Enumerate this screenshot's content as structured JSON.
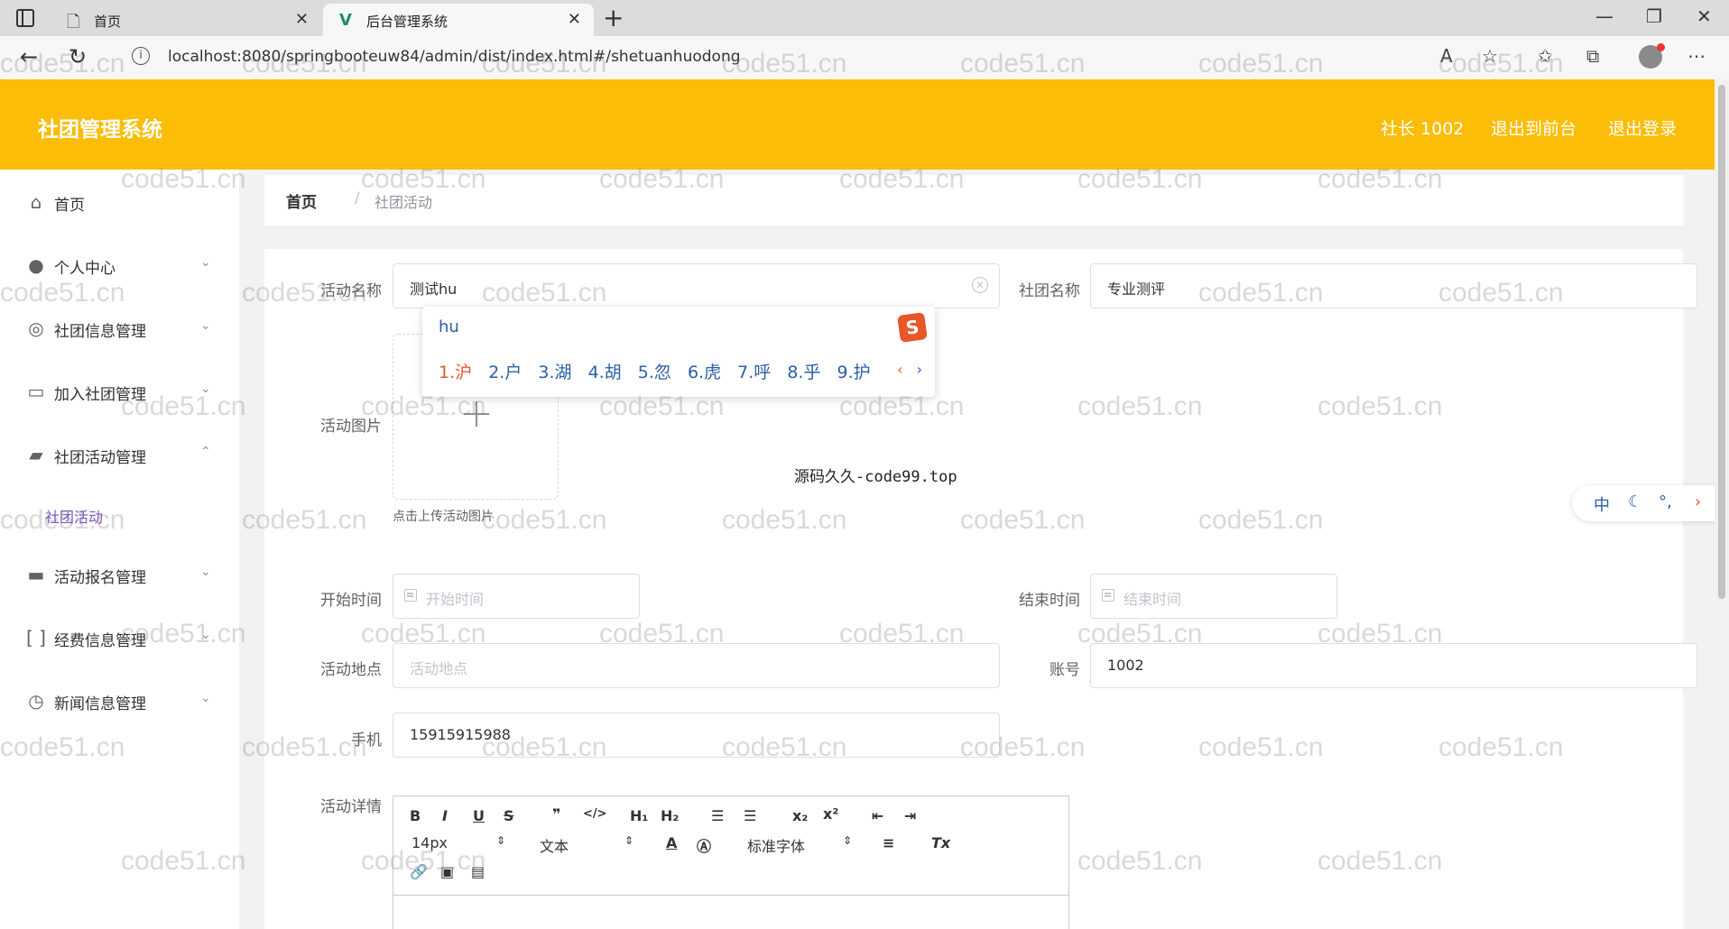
{
  "browser": {
    "tabs": [
      {
        "title": "首页",
        "icon": "page-icon"
      },
      {
        "title": "后台管理系统",
        "icon": "vue-icon"
      }
    ],
    "url": "localhost:8080/springbooteuw84/admin/dist/index.html#/shetuanhuodong"
  },
  "header": {
    "title": "社团管理系统",
    "user": "社长 1002",
    "to_front": "退出到前台",
    "logout": "退出登录",
    "color": "#fbbd08"
  },
  "sidebar": {
    "items": [
      {
        "label": "首页",
        "icon": "home-icon"
      },
      {
        "label": "个人中心",
        "icon": "user-icon"
      },
      {
        "label": "社团信息管理",
        "icon": "globe-icon"
      },
      {
        "label": "加入社团管理",
        "icon": "chat-icon"
      },
      {
        "label": "社团活动管理",
        "icon": "ticket-icon"
      },
      {
        "label": "活动报名管理",
        "icon": "briefcase-icon"
      },
      {
        "label": "经费信息管理",
        "icon": "bracket-icon"
      },
      {
        "label": "新闻信息管理",
        "icon": "clock-icon"
      }
    ],
    "active_sub": "社团活动"
  },
  "breadcrumb": {
    "home": "首页",
    "sep": "/",
    "current": "社团活动"
  },
  "form": {
    "name_label": "活动名称",
    "name_value": "测试hu",
    "club_label": "社团名称",
    "club_value": "专业测评",
    "image_label": "活动图片",
    "upload_tip": "点击上传活动图片",
    "start_label": "开始时间",
    "start_placeholder": "开始时间",
    "end_label": "结束时间",
    "end_placeholder": "结束时间",
    "place_label": "活动地点",
    "place_placeholder": "活动地点",
    "account_label": "账号",
    "account_value": "1002",
    "phone_label": "手机",
    "phone_value": "15915915988",
    "detail_label": "活动详情"
  },
  "editor": {
    "font_size": "14px",
    "block_type": "文本",
    "font_family": "标准字体"
  },
  "ime": {
    "input": "hu",
    "candidates": [
      "1.沪",
      "2.户",
      "3.湖",
      "4.胡",
      "5.忽",
      "6.虎",
      "7.呼",
      "8.乎",
      "9.护"
    ],
    "float_label": "中"
  },
  "watermark": "code51.cn",
  "center_watermark": "源码久久-code99.top"
}
